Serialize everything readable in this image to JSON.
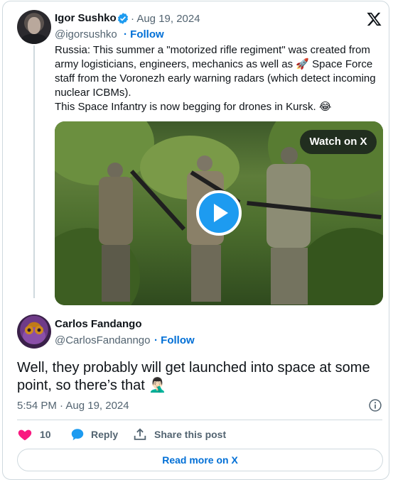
{
  "tweet": {
    "author_name": "Igor Sushko",
    "date": "· Aug 19, 2024",
    "handle": "@igorsushko",
    "follow_label": "· Follow",
    "text_line1": "Russia: This summer a \"motorized rifle regiment\" was created from army logisticians, engineers, mechanics as well as 🚀 Space Force staff from the Voronezh early warning radars (which detect incoming nuclear ICBMs).",
    "text_line2": "This Space Infantry is now begging for drones in Kursk. 😂",
    "media": {
      "watch_label": "Watch on X"
    }
  },
  "reply": {
    "author_name": "Carlos Fandango",
    "handle": "@CarlosFandanngo",
    "follow_label": "· Follow",
    "text": "Well, they probably will get launched into space at some point, so there’s that 🤦🏻‍♂️",
    "timestamp": "5:54 PM · Aug 19, 2024"
  },
  "actions": {
    "like_count": "10",
    "reply_label": "Reply",
    "share_label": "Share this post",
    "read_more_label": "Read more on X"
  },
  "icons": {
    "verified": "verified-badge-icon",
    "logo": "x-logo-icon",
    "info": "info-icon",
    "like": "heart-icon",
    "reply": "reply-bubble-icon",
    "share": "share-icon",
    "play": "play-icon"
  },
  "colors": {
    "accent": "#1d9bf0",
    "link": "#006fd6",
    "like": "#f91880",
    "muted": "#536471",
    "border": "#cfd9de"
  }
}
